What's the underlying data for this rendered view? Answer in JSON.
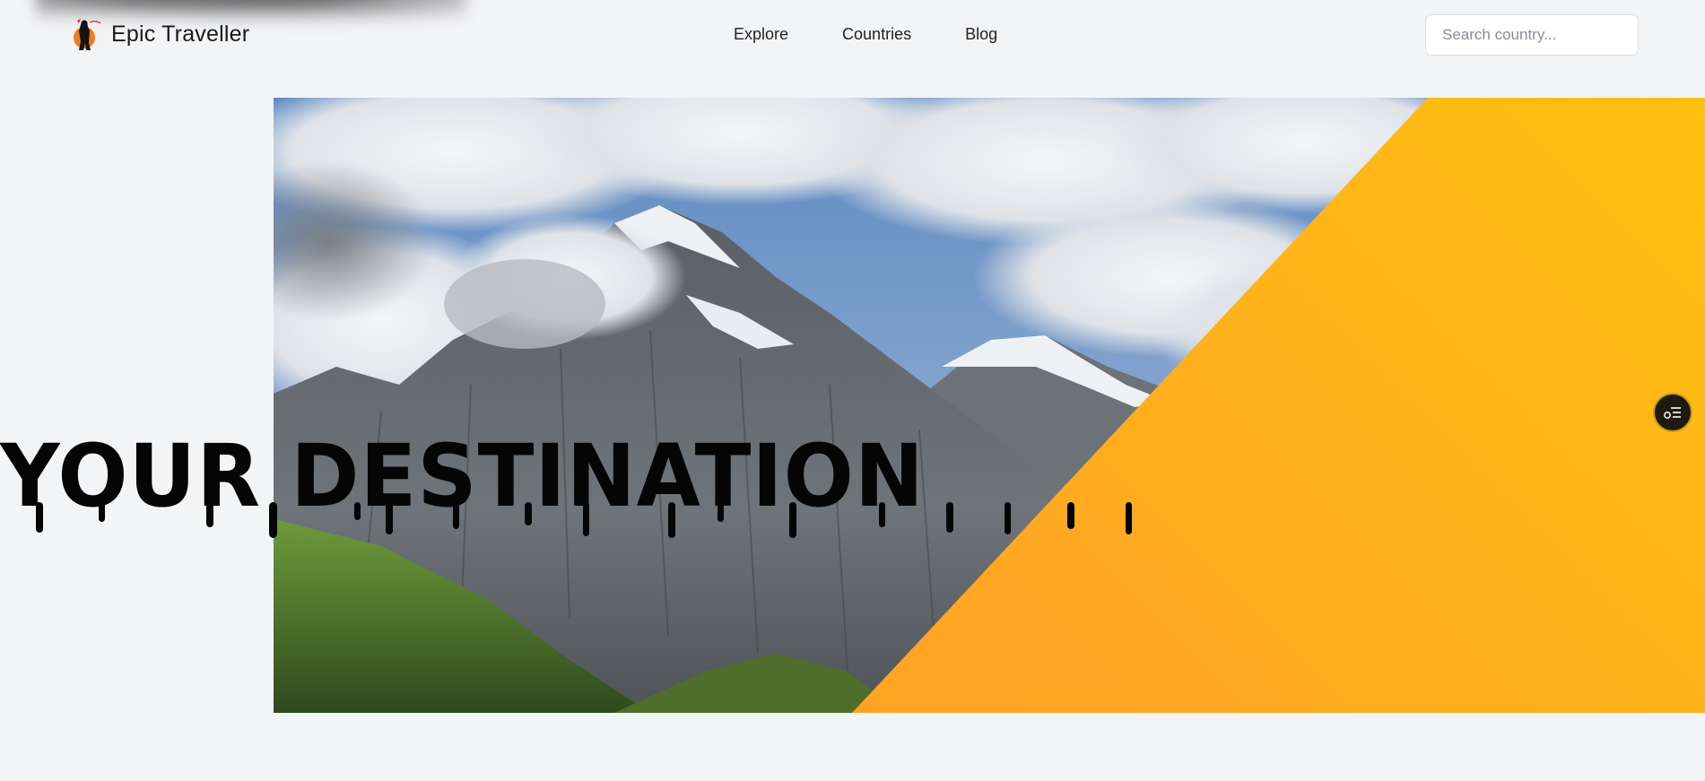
{
  "brand": {
    "name": "Epic Traveller",
    "logo_icon": "traveller-logo-icon"
  },
  "nav": {
    "items": [
      {
        "label": "Explore"
      },
      {
        "label": "Countries"
      },
      {
        "label": "Blog"
      }
    ]
  },
  "search": {
    "placeholder": "Search country...",
    "value": ""
  },
  "hero": {
    "title": "YOUR DESTINATION",
    "image": "mountain-landscape-photo",
    "accent_color": "#ffb21c"
  },
  "floating_button": {
    "icon": "menu-list-icon"
  }
}
